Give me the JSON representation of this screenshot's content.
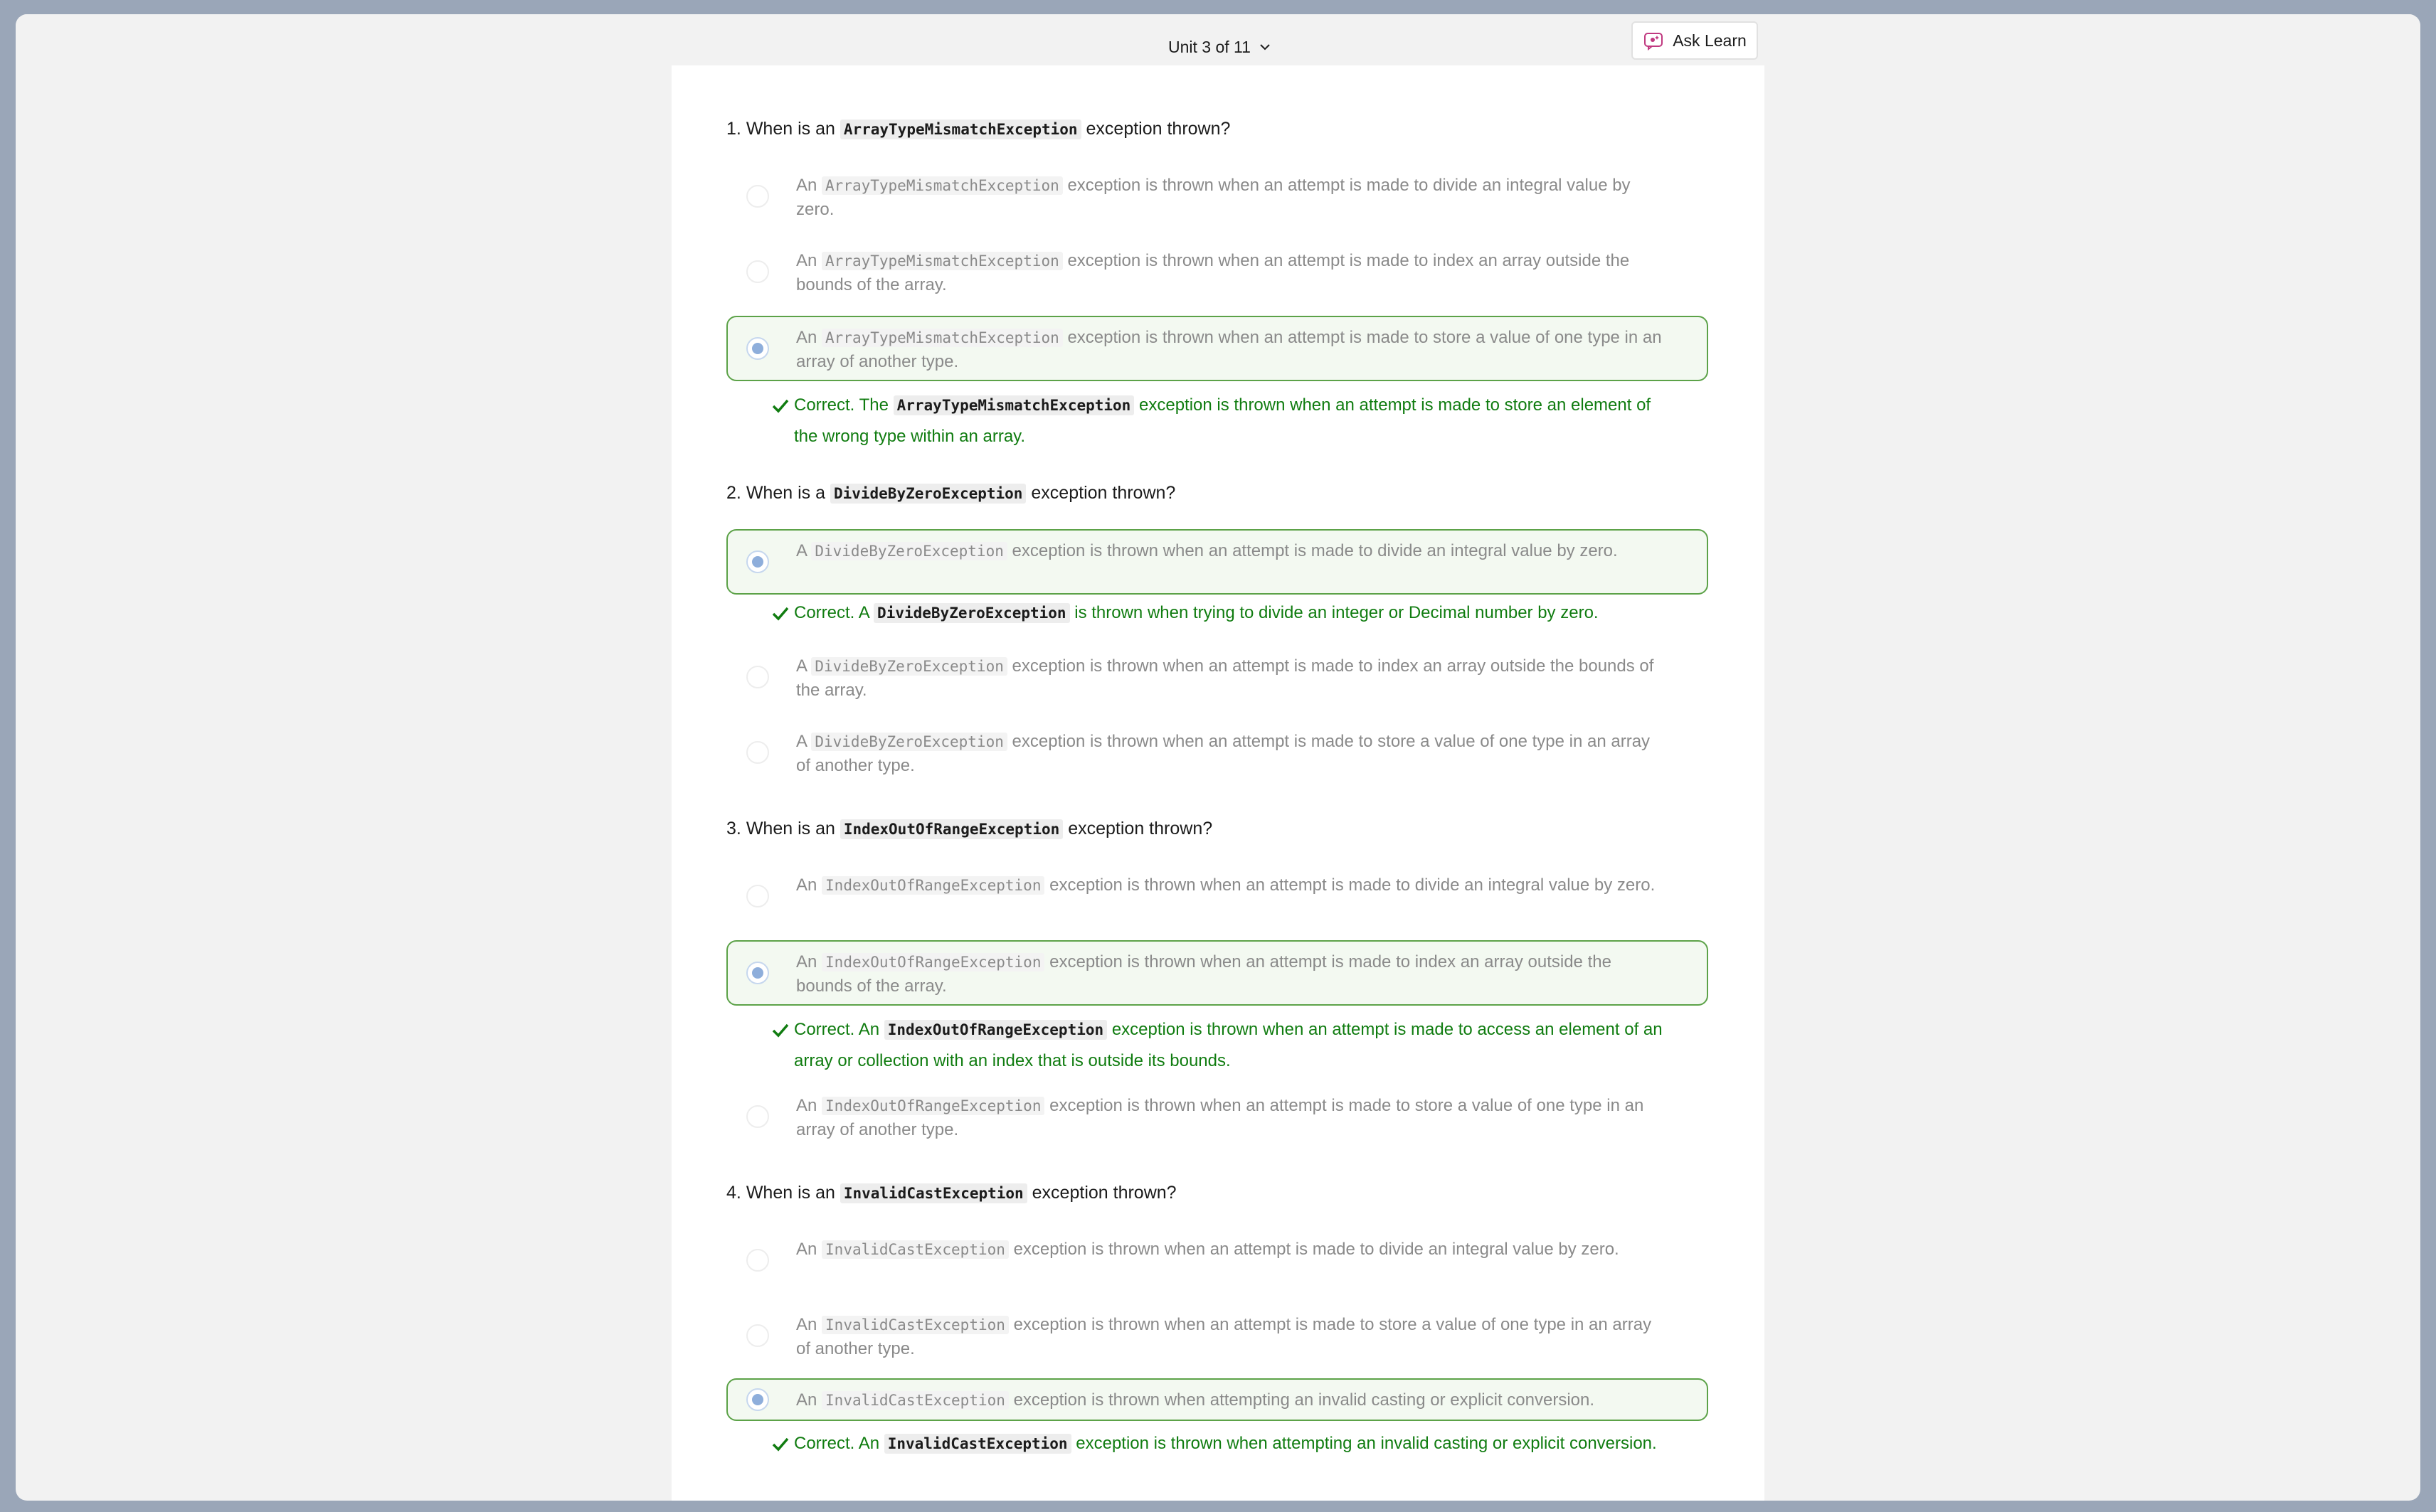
{
  "header": {
    "unit_label": "Unit 3 of 11",
    "ask_learn_label": "Ask Learn"
  },
  "questions": [
    {
      "number": "1.",
      "prefix": "When is an",
      "code": "ArrayTypeMismatchException",
      "suffix": "exception thrown?",
      "options": [
        {
          "pre": "An",
          "code": "ArrayTypeMismatchException",
          "text": "exception is thrown when an attempt is made to divide an integral value by zero.",
          "selected": false
        },
        {
          "pre": "An",
          "code": "ArrayTypeMismatchException",
          "text": "exception is thrown when an attempt is made to index an array outside the bounds of the array.",
          "selected": false
        },
        {
          "pre": "An",
          "code": "ArrayTypeMismatchException",
          "text": "exception is thrown when an attempt is made to store a value of one type in an array of another type.",
          "selected": true
        }
      ],
      "feedback": {
        "pre": "Correct. The",
        "code": "ArrayTypeMismatchException",
        "text": "exception is thrown when an attempt is made to store an element of the wrong type within an array."
      }
    },
    {
      "number": "2.",
      "prefix": "When is a",
      "code": "DivideByZeroException",
      "suffix": "exception thrown?",
      "options": [
        {
          "pre": "A",
          "code": "DivideByZeroException",
          "text": "exception is thrown when an attempt is made to divide an integral value by zero.",
          "selected": true
        },
        {
          "pre": "A",
          "code": "DivideByZeroException",
          "text": "exception is thrown when an attempt is made to index an array outside the bounds of the array.",
          "selected": false
        },
        {
          "pre": "A",
          "code": "DivideByZeroException",
          "text": "exception is thrown when an attempt is made to store a value of one type in an array of another type.",
          "selected": false
        }
      ],
      "feedback": {
        "pre": "Correct. A",
        "code": "DivideByZeroException",
        "text": "is thrown when trying to divide an integer or Decimal number by zero."
      }
    },
    {
      "number": "3.",
      "prefix": "When is an",
      "code": "IndexOutOfRangeException",
      "suffix": "exception thrown?",
      "options": [
        {
          "pre": "An",
          "code": "IndexOutOfRangeException",
          "text": "exception is thrown when an attempt is made to divide an integral value by zero.",
          "selected": false
        },
        {
          "pre": "An",
          "code": "IndexOutOfRangeException",
          "text": "exception is thrown when an attempt is made to index an array outside the bounds of the array.",
          "selected": true
        },
        {
          "pre": "An",
          "code": "IndexOutOfRangeException",
          "text": "exception is thrown when an attempt is made to store a value of one type in an array of another type.",
          "selected": false
        }
      ],
      "feedback": {
        "pre": "Correct. An",
        "code": "IndexOutOfRangeException",
        "text": "exception is thrown when an attempt is made to access an element of an array or collection with an index that is outside its bounds."
      }
    },
    {
      "number": "4.",
      "prefix": "When is an",
      "code": "InvalidCastException",
      "suffix": "exception thrown?",
      "options": [
        {
          "pre": "An",
          "code": "InvalidCastException",
          "text": "exception is thrown when an attempt is made to divide an integral value by zero.",
          "selected": false
        },
        {
          "pre": "An",
          "code": "InvalidCastException",
          "text": "exception is thrown when an attempt is made to store a value of one type in an array of another type.",
          "selected": false
        },
        {
          "pre": "An",
          "code": "InvalidCastException",
          "text": "exception is thrown when attempting an invalid casting or explicit conversion.",
          "selected": true
        }
      ],
      "feedback": {
        "pre": "Correct. An",
        "code": "InvalidCastException",
        "text": "exception is thrown when attempting an invalid casting or explicit conversion."
      }
    }
  ]
}
